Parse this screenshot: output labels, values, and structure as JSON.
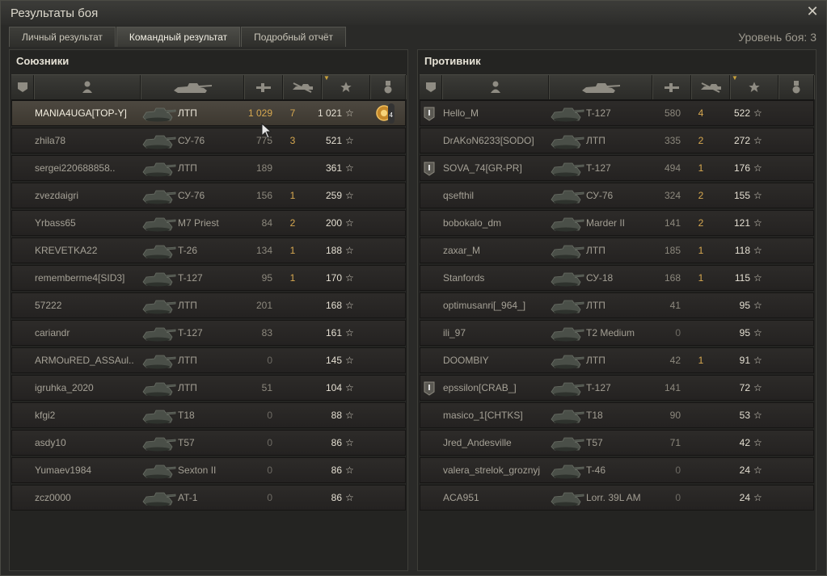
{
  "window": {
    "title": "Результаты боя",
    "close_icon": "close-icon"
  },
  "tabs": [
    {
      "label": "Личный результат",
      "active": false
    },
    {
      "label": "Командный результат",
      "active": true
    },
    {
      "label": "Подробный отчёт",
      "active": false
    }
  ],
  "level_label": "Уровень боя: 3",
  "allies": {
    "title": "Союзники",
    "rows": [
      {
        "name": "MANIA4UGA[TOP-Y]",
        "vehicle": "ЛТП",
        "damage": "1 029",
        "kills": "7",
        "xp": "1 021",
        "me": true,
        "medal_count": "4"
      },
      {
        "name": "zhila78",
        "vehicle": "СУ-76",
        "damage": "775",
        "kills": "3",
        "xp": "521"
      },
      {
        "name": "sergei220688858..",
        "vehicle": "ЛТП",
        "damage": "189",
        "kills": "",
        "xp": "361"
      },
      {
        "name": "zvezdaigri",
        "vehicle": "СУ-76",
        "damage": "156",
        "kills": "1",
        "xp": "259"
      },
      {
        "name": "Yrbass65",
        "vehicle": "M7 Priest",
        "damage": "84",
        "kills": "2",
        "xp": "200"
      },
      {
        "name": "KREVETKA22",
        "vehicle": "T-26",
        "damage": "134",
        "kills": "1",
        "xp": "188"
      },
      {
        "name": "rememberme4[SID3]",
        "vehicle": "T-127",
        "damage": "95",
        "kills": "1",
        "xp": "170"
      },
      {
        "name": "57222",
        "vehicle": "ЛТП",
        "damage": "201",
        "kills": "",
        "xp": "168"
      },
      {
        "name": "cariandr",
        "vehicle": "T-127",
        "damage": "83",
        "kills": "",
        "xp": "161"
      },
      {
        "name": "ARMOuRED_ASSAul..",
        "vehicle": "ЛТП",
        "damage": "0",
        "kills": "",
        "xp": "145"
      },
      {
        "name": "igruhka_2020",
        "vehicle": "ЛТП",
        "damage": "51",
        "kills": "",
        "xp": "104"
      },
      {
        "name": "kfgi2",
        "vehicle": "T18",
        "damage": "0",
        "kills": "",
        "xp": "88"
      },
      {
        "name": "asdy10",
        "vehicle": "T57",
        "damage": "0",
        "kills": "",
        "xp": "86"
      },
      {
        "name": "Yumaev1984",
        "vehicle": "Sexton II",
        "damage": "0",
        "kills": "",
        "xp": "86"
      },
      {
        "name": "zcz0000",
        "vehicle": "AT-1",
        "damage": "0",
        "kills": "",
        "xp": "86"
      }
    ]
  },
  "enemies": {
    "title": "Противник",
    "rows": [
      {
        "name": "Hello_M",
        "vehicle": "T-127",
        "damage": "580",
        "kills": "4",
        "xp": "522",
        "rank": true
      },
      {
        "name": "DrAKoN6233[SODO]",
        "vehicle": "ЛТП",
        "damage": "335",
        "kills": "2",
        "xp": "272"
      },
      {
        "name": "SOVA_74[GR-PR]",
        "vehicle": "T-127",
        "damage": "494",
        "kills": "1",
        "xp": "176",
        "rank": true
      },
      {
        "name": "qsefthil",
        "vehicle": "СУ-76",
        "damage": "324",
        "kills": "2",
        "xp": "155"
      },
      {
        "name": "bobokalo_dm",
        "vehicle": "Marder II",
        "damage": "141",
        "kills": "2",
        "xp": "121"
      },
      {
        "name": "zaxar_M",
        "vehicle": "ЛТП",
        "damage": "185",
        "kills": "1",
        "xp": "118"
      },
      {
        "name": "Stanfords",
        "vehicle": "СУ-18",
        "damage": "168",
        "kills": "1",
        "xp": "115"
      },
      {
        "name": "optimusanri[_964_]",
        "vehicle": "ЛТП",
        "damage": "41",
        "kills": "",
        "xp": "95"
      },
      {
        "name": "ili_97",
        "vehicle": "T2 Medium",
        "damage": "0",
        "kills": "",
        "xp": "95"
      },
      {
        "name": "DOOMBIY",
        "vehicle": "ЛТП",
        "damage": "42",
        "kills": "1",
        "xp": "91"
      },
      {
        "name": "epssilon[CRAB_]",
        "vehicle": "T-127",
        "damage": "141",
        "kills": "",
        "xp": "72",
        "rank": true
      },
      {
        "name": "masico_1[CHTKS]",
        "vehicle": "T18",
        "damage": "90",
        "kills": "",
        "xp": "53"
      },
      {
        "name": "Jred_Andesville",
        "vehicle": "T57",
        "damage": "71",
        "kills": "",
        "xp": "42"
      },
      {
        "name": "valera_strelok_groznyj",
        "vehicle": "T-46",
        "damage": "0",
        "kills": "",
        "xp": "24"
      },
      {
        "name": "ACA951",
        "vehicle": "Lorr. 39L AM",
        "damage": "0",
        "kills": "",
        "xp": "24"
      }
    ]
  },
  "columns": [
    "rank-icon",
    "player-icon",
    "tank-icon",
    "damage-icon",
    "kills-icon",
    "xp-star-icon",
    "medal-icon"
  ],
  "colors": {
    "accent": "#d7a850",
    "background": "#242422",
    "me_row": "#4d4840"
  }
}
